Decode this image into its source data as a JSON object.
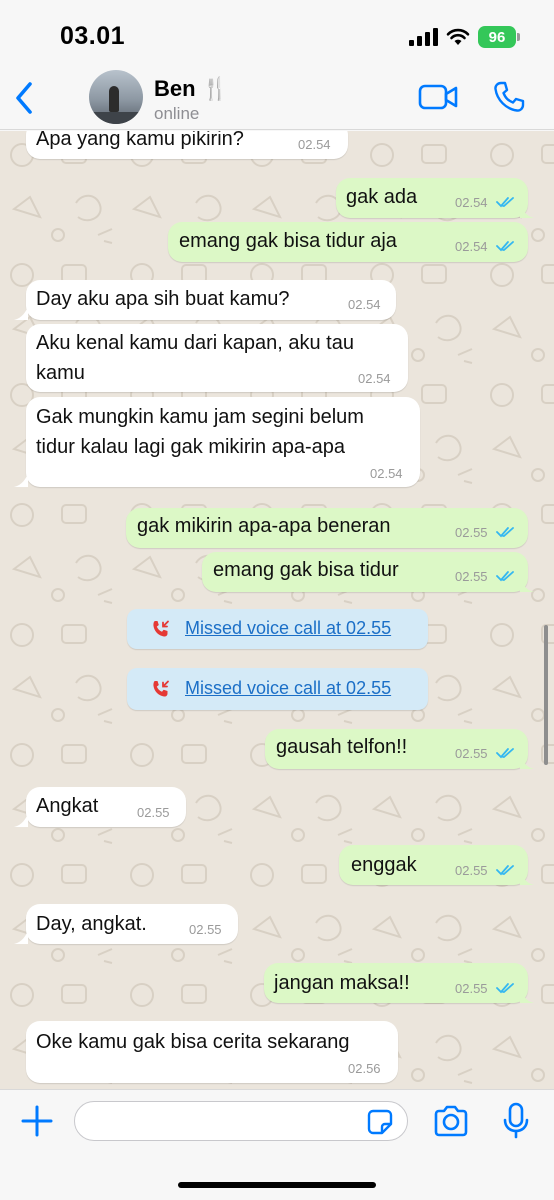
{
  "status_bar": {
    "time": "03.01",
    "battery": "96"
  },
  "header": {
    "back_label": "",
    "name": "Ben 🍴",
    "status": "online"
  },
  "messages": [
    {
      "dir": "in",
      "text": "Apa yang kamu pikirin?",
      "time": "02.54"
    },
    {
      "dir": "out",
      "text": "gak ada",
      "time": "02.54",
      "read": true
    },
    {
      "dir": "out",
      "text": "emang gak bisa tidur aja",
      "time": "02.54",
      "read": true
    },
    {
      "dir": "in",
      "text": "Day aku apa sih buat kamu?",
      "time": "02.54"
    },
    {
      "dir": "in",
      "lines": [
        "Aku kenal kamu dari kapan, aku tau",
        "kamu"
      ],
      "time": "02.54"
    },
    {
      "dir": "in",
      "lines": [
        "Gak mungkin kamu jam segini belum",
        "tidur kalau lagi gak mikirin apa-apa"
      ],
      "time": "02.54"
    },
    {
      "dir": "out",
      "text": "gak mikirin apa-apa beneran",
      "time": "02.55",
      "read": true
    },
    {
      "dir": "out",
      "text": "emang gak bisa tidur",
      "time": "02.55",
      "read": true
    },
    {
      "dir": "call",
      "text": "Missed voice call at 02.55"
    },
    {
      "dir": "call",
      "text": "Missed voice call at 02.55"
    },
    {
      "dir": "out",
      "text": "gausah telfon!!",
      "time": "02.55",
      "read": true
    },
    {
      "dir": "in",
      "text": "Angkat",
      "time": "02.55"
    },
    {
      "dir": "out",
      "text": "enggak",
      "time": "02.55",
      "read": true
    },
    {
      "dir": "in",
      "text": "Day, angkat.",
      "time": "02.55"
    },
    {
      "dir": "out",
      "text": "jangan maksa!!",
      "time": "02.55",
      "read": true
    },
    {
      "dir": "in",
      "text": "Oke kamu gak bisa cerita sekarang",
      "time": "02.56"
    }
  ],
  "input": {
    "value": "",
    "placeholder": ""
  },
  "icons": {
    "back": "chevron-left-icon",
    "video": "video-camera-icon",
    "phone": "phone-icon",
    "plus": "plus-icon",
    "sticker": "sticker-icon",
    "camera": "camera-icon",
    "mic": "microphone-icon",
    "missed_call": "missed-call-icon",
    "read": "double-check-icon"
  },
  "colors": {
    "accent": "#007aff",
    "incoming_bubble": "#ffffff",
    "outgoing_bubble": "#dcf8c6",
    "call_bubble": "#d4eaf7",
    "missed_call": "#e53935",
    "read_ticks": "#34b7f1",
    "battery": "#34c759",
    "chat_background": "#ebe5dc"
  }
}
